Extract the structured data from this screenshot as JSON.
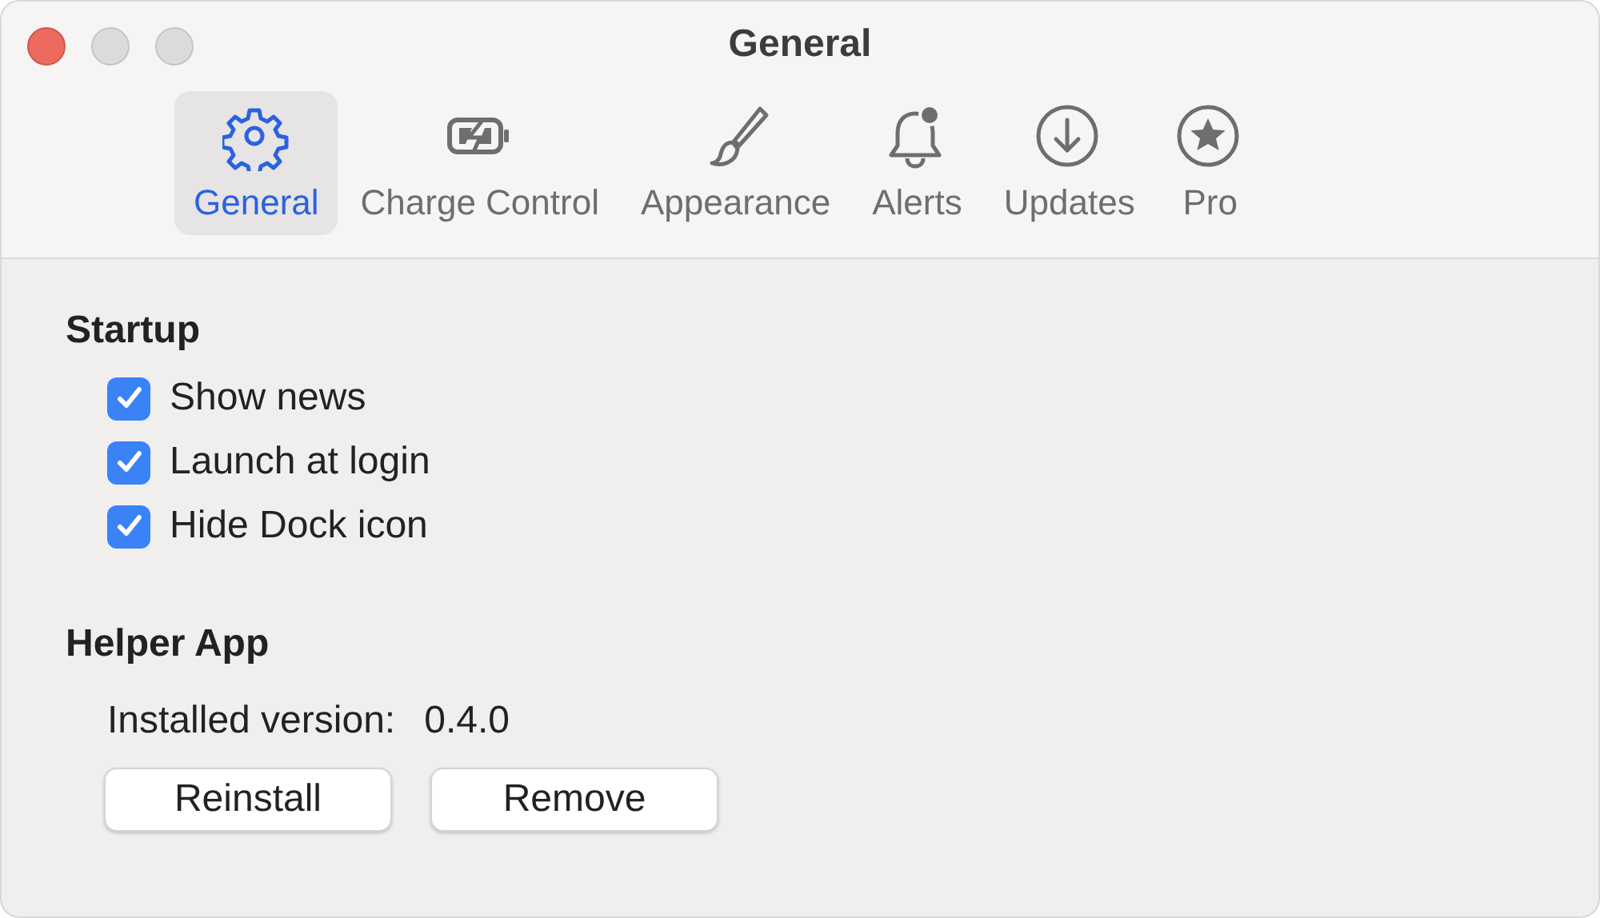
{
  "window": {
    "title": "General"
  },
  "tabs": [
    {
      "label": "General",
      "kind": "gear",
      "selected": true
    },
    {
      "label": "Charge Control",
      "kind": "battery",
      "selected": false
    },
    {
      "label": "Appearance",
      "kind": "brush",
      "selected": false
    },
    {
      "label": "Alerts",
      "kind": "bell",
      "selected": false
    },
    {
      "label": "Updates",
      "kind": "download",
      "selected": false
    },
    {
      "label": "Pro",
      "kind": "star",
      "selected": false
    }
  ],
  "startup": {
    "heading": "Startup",
    "options": [
      {
        "label": "Show news",
        "checked": true
      },
      {
        "label": "Launch at login",
        "checked": true
      },
      {
        "label": "Hide Dock icon",
        "checked": true
      }
    ]
  },
  "helper_app": {
    "heading": "Helper App",
    "version_label": "Installed version:",
    "version": "0.4.0",
    "buttons": [
      "Reinstall",
      "Remove"
    ]
  }
}
